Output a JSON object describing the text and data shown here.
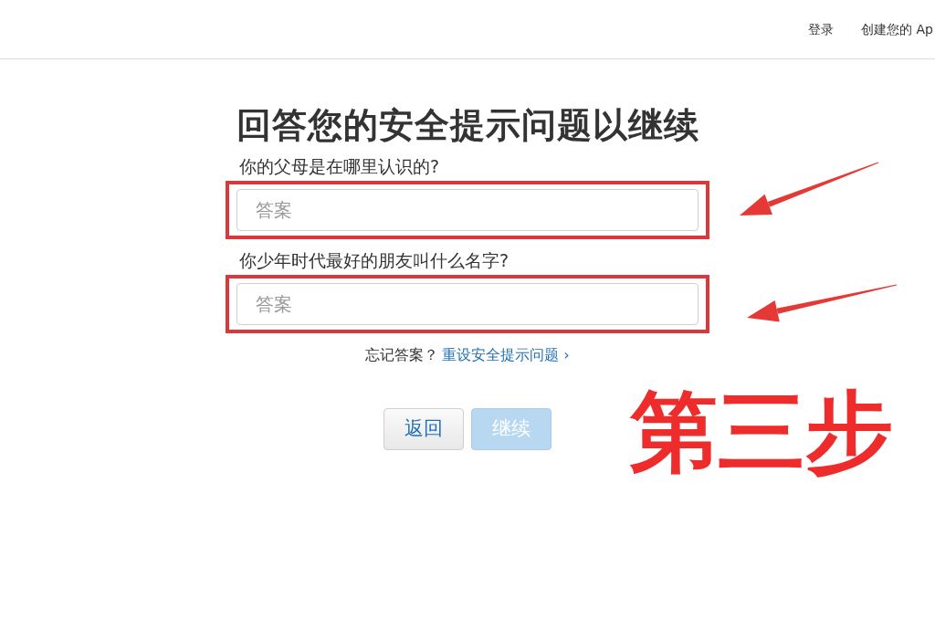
{
  "header": {
    "nav": [
      {
        "label": "登录"
      },
      {
        "label": "创建您的 Ap"
      }
    ]
  },
  "title": "回答您的安全提示问题以继续",
  "questions": [
    {
      "label": "你的父母是在哪里认识的?",
      "placeholder": "答案",
      "highlighted": true
    },
    {
      "label": "你少年时代最好的朋友叫什么名字?",
      "placeholder": "答案",
      "highlighted": true
    }
  ],
  "forgot": {
    "text": "忘记答案？",
    "link": "重设安全提示问题",
    "chevron": "›"
  },
  "buttons": [
    {
      "label": "返回",
      "kind": "secondary",
      "disabled": false
    },
    {
      "label": "继续",
      "kind": "primary",
      "disabled": true
    }
  ],
  "annotation": {
    "step_label": "第三步"
  }
}
